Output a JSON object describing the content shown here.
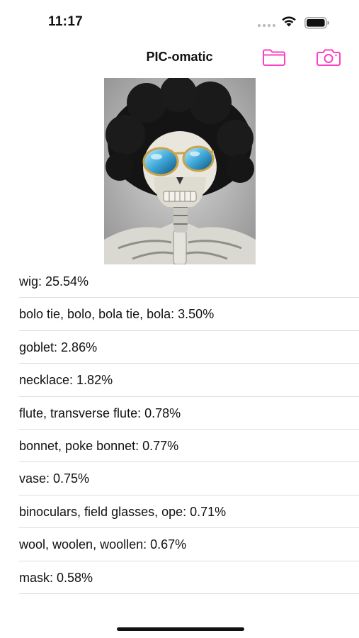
{
  "status_bar": {
    "time": "11:17"
  },
  "nav": {
    "title": "PIC-omatic",
    "folder_icon": "folder-icon",
    "camera_icon": "camera-icon"
  },
  "accent_color": "#ff3fc4",
  "photo": {
    "description": "skeleton wearing black afro wig and blue mirrored sunglasses"
  },
  "results": [
    {
      "label": "wig: 25.54%"
    },
    {
      "label": "bolo tie, bolo, bola tie, bola: 3.50%"
    },
    {
      "label": "goblet: 2.86%"
    },
    {
      "label": "necklace: 1.82%"
    },
    {
      "label": "flute, transverse flute: 0.78%"
    },
    {
      "label": "bonnet, poke bonnet: 0.77%"
    },
    {
      "label": "vase: 0.75%"
    },
    {
      "label": "binoculars, field glasses, ope: 0.71%"
    },
    {
      "label": "wool, woolen, woollen: 0.67%"
    },
    {
      "label": "mask: 0.58%"
    }
  ]
}
